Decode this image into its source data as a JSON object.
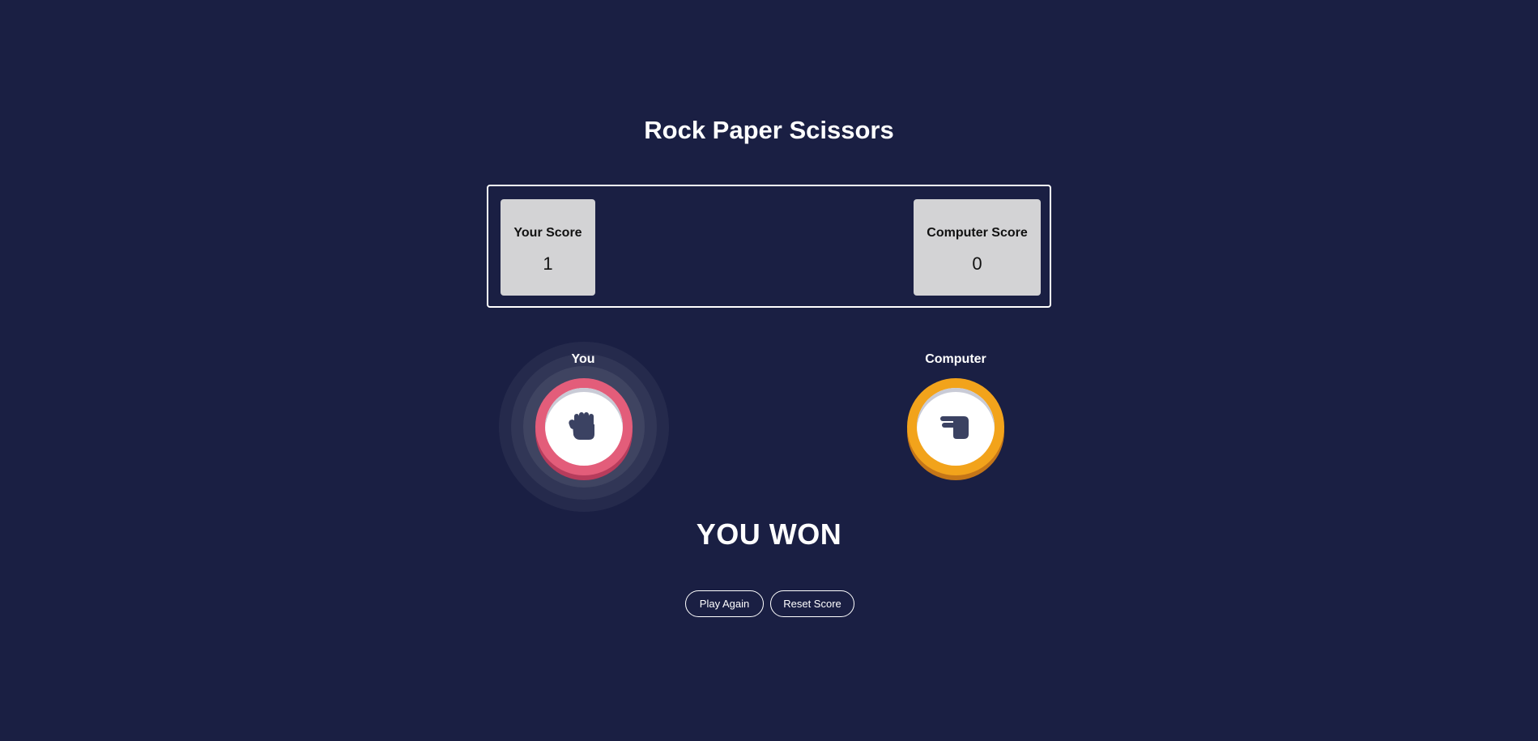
{
  "title": "Rock Paper Scissors",
  "score": {
    "you_label": "Your Score",
    "you_value": "1",
    "computer_label": "Computer Score",
    "computer_value": "0"
  },
  "players": {
    "you_label": "You",
    "you_choice": "rock",
    "you_choice_icon": "fist-icon",
    "you_color": "#e35d7a",
    "computer_label": "Computer",
    "computer_choice": "scissors",
    "computer_choice_icon": "scissors-hand-icon",
    "computer_color": "#f2a31b"
  },
  "result": "YOU WON",
  "buttons": {
    "play_again": "Play Again",
    "reset_score": "Reset Score"
  },
  "colors": {
    "background": "#1a1f43",
    "card": "#d3d3d5",
    "icon": "#3b4262"
  }
}
